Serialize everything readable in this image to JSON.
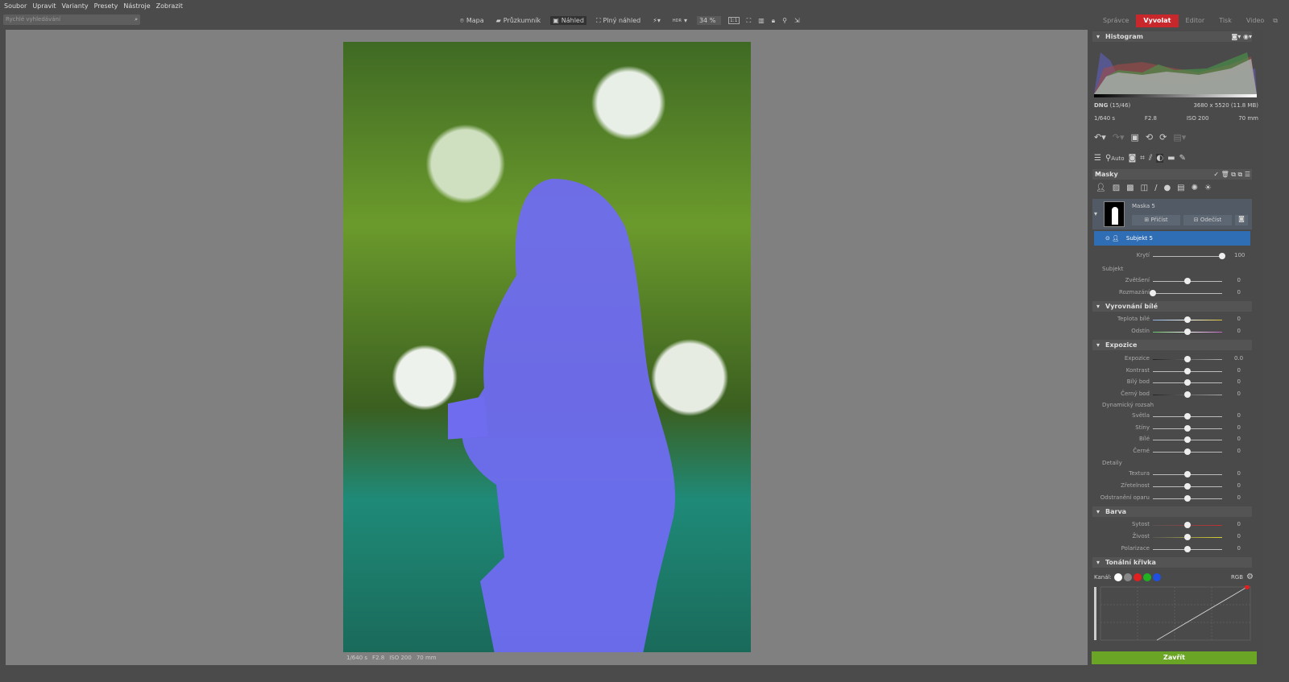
{
  "menu": [
    "Soubor",
    "Upravit",
    "Varianty",
    "Presety",
    "Nástroje",
    "Zobrazit"
  ],
  "search": {
    "placeholder": "Rychlé vyhledávání"
  },
  "toolbar": {
    "map": "Mapa",
    "browser": "Průzkumník",
    "preview": "Náhled",
    "fullscreen": "Plný náhled",
    "hdr": "HDR",
    "zoom": "34 %",
    "one_to_one": "1:1"
  },
  "modes": [
    "Správce",
    "Vyvolat",
    "Editor",
    "Tisk",
    "Video"
  ],
  "active_mode": "Vyvolat",
  "photo_info": {
    "shutter": "1/640 s",
    "aperture": "F2.8",
    "iso": "ISO 200",
    "focal": "70 mm"
  },
  "histogram": {
    "title": "Histogram",
    "format": "DNG",
    "index": "(15/46)",
    "dimensions": "3680 x 5520 (11.8 MB)",
    "shutter": "1/640 s",
    "aperture": "F2.8",
    "iso": "ISO 200",
    "focal": "70 mm"
  },
  "tools": {
    "auto": "Auto"
  },
  "masks": {
    "title": "Masky",
    "mask_name": "Maska 5",
    "add": "Přičíst",
    "subtract": "Odečíst",
    "subject": "Subjekt 5"
  },
  "opacity": {
    "label": "Krytí",
    "value": "100",
    "fraction": 1
  },
  "groups": {
    "subject": "Subjekt",
    "dynamic": "Dynamický rozsah",
    "details": "Detaily"
  },
  "sections": {
    "wb": "Vyrovnání bílé",
    "exposure": "Expozice",
    "color": "Barva",
    "curve": "Tonální křivka"
  },
  "sliders": {
    "subject": [
      {
        "label": "Zvětšení",
        "value": "0",
        "fraction": 0.5
      },
      {
        "label": "Rozmazání",
        "value": "0",
        "fraction": 0
      }
    ],
    "wb": [
      {
        "label": "Teplota bílé",
        "value": "0",
        "fraction": 0.5
      },
      {
        "label": "Odstín",
        "value": "0",
        "fraction": 0.5
      }
    ],
    "exposure": [
      {
        "label": "Expozice",
        "value": "0.0",
        "fraction": 0.5
      },
      {
        "label": "Kontrast",
        "value": "0",
        "fraction": 0.5
      },
      {
        "label": "Bílý bod",
        "value": "0",
        "fraction": 0.5
      },
      {
        "label": "Černý bod",
        "value": "0",
        "fraction": 0.5
      }
    ],
    "dynamic": [
      {
        "label": "Světla",
        "value": "0",
        "fraction": 0.5
      },
      {
        "label": "Stíny",
        "value": "0",
        "fraction": 0.5
      },
      {
        "label": "Bílé",
        "value": "0",
        "fraction": 0.5
      },
      {
        "label": "Černé",
        "value": "0",
        "fraction": 0.5
      }
    ],
    "details": [
      {
        "label": "Textura",
        "value": "0",
        "fraction": 0.5
      },
      {
        "label": "Zřetelnost",
        "value": "0",
        "fraction": 0.5
      },
      {
        "label": "Odstranění oparu",
        "value": "0",
        "fraction": 0.5
      }
    ],
    "color": [
      {
        "label": "Sytost",
        "value": "0",
        "fraction": 0.5
      },
      {
        "label": "Živost",
        "value": "0",
        "fraction": 0.5
      },
      {
        "label": "Polarizace",
        "value": "0",
        "fraction": 0.5
      }
    ]
  },
  "curve": {
    "channel_label": "Kanál:",
    "mode": "RGB",
    "channels": [
      "#ffffff",
      "#888888",
      "#e02020",
      "#20b020",
      "#2050e0"
    ]
  },
  "close_label": "Zavřít",
  "colors": {
    "accent": "#c8282c",
    "selection": "#2f6db5",
    "close": "#6aa526",
    "mask_overlay": "#6f6cf0"
  }
}
